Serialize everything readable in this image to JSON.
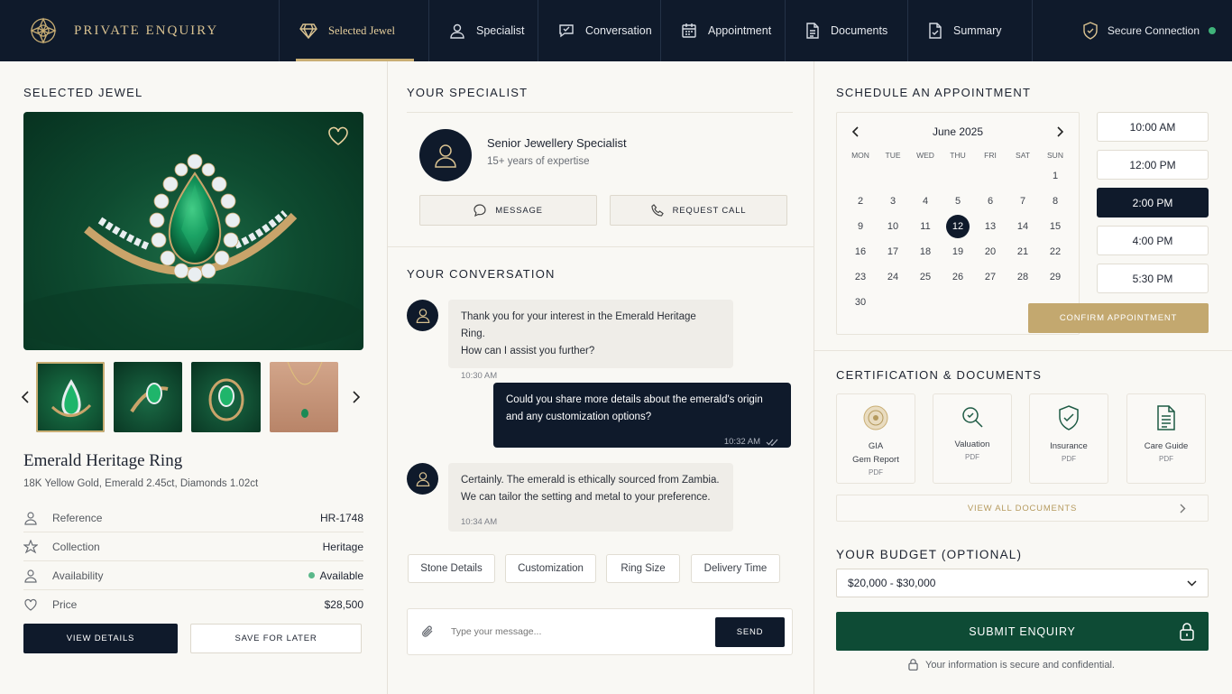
{
  "brand": {
    "name": "PRIVATE ENQUIRY"
  },
  "nav": {
    "items": [
      {
        "label": "Selected Jewel",
        "icon": "diamond-icon",
        "active": true
      },
      {
        "label": "Specialist",
        "icon": "user-icon"
      },
      {
        "label": "Conversation",
        "icon": "chat-icon"
      },
      {
        "label": "Appointment",
        "icon": "calendar-icon"
      },
      {
        "label": "Documents",
        "icon": "document-icon"
      },
      {
        "label": "Summary",
        "icon": "summary-icon"
      }
    ],
    "secure_label": "Secure Connection"
  },
  "jewel": {
    "section_title": "SELECTED JEWEL",
    "name": "Emerald Heritage Ring",
    "description": "18K Yellow Gold, Emerald 2.45ct, Diamonds 1.02ct",
    "specs": [
      {
        "label": "Reference",
        "value": "HR-1748",
        "icon": "person-icon"
      },
      {
        "label": "Collection",
        "value": "Heritage",
        "icon": "star-icon"
      },
      {
        "label": "Availability",
        "value": "Available",
        "icon": "person-icon"
      },
      {
        "label": "Price",
        "value": "$28,500",
        "icon": "tag-icon"
      }
    ],
    "view_details": "VIEW DETAILS",
    "save_later": "SAVE FOR LATER"
  },
  "specialist": {
    "section_title": "YOUR SPECIALIST",
    "title": "Senior Jewellery Specialist",
    "subtitle": "15+ years of expertise",
    "message_btn": "MESSAGE",
    "call_btn": "REQUEST CALL"
  },
  "conversation": {
    "section_title": "YOUR CONVERSATION",
    "messages": [
      {
        "from": "specialist",
        "lines": [
          "Thank you for your interest in the Emerald Heritage Ring.",
          "How can I assist you further?"
        ],
        "time": "10:30 AM"
      },
      {
        "from": "user",
        "lines": [
          "Could you share more details about the emerald's origin",
          "and any customization options?"
        ],
        "time": "10:32 AM"
      },
      {
        "from": "specialist",
        "lines": [
          "Certainly. The emerald is ethically sourced from Zambia.",
          "We can tailor the setting and metal to your preference."
        ],
        "time": "10:34 AM"
      }
    ],
    "chips": [
      "Stone Details",
      "Customization",
      "Ring Size",
      "Delivery Time"
    ],
    "input_placeholder": "Type your message...",
    "send": "SEND"
  },
  "appointment": {
    "section_title": "SCHEDULE AN APPOINTMENT",
    "month": "June 2025",
    "weekdays": [
      "MON",
      "TUE",
      "WED",
      "THU",
      "FRI",
      "SAT",
      "SUN"
    ],
    "days": [
      "",
      "",
      "",
      "",
      "",
      "",
      "1",
      "2",
      "3",
      "4",
      "5",
      "6",
      "7",
      "8",
      "9",
      "10",
      "11",
      "12",
      "13",
      "14",
      "15",
      "16",
      "17",
      "18",
      "19",
      "20",
      "21",
      "22",
      "23",
      "24",
      "25",
      "26",
      "27",
      "28",
      "29",
      "30"
    ],
    "selected_day": "12",
    "slots": [
      "10:00 AM",
      "12:00 PM",
      "2:00 PM",
      "4:00 PM",
      "5:30 PM"
    ],
    "selected_slot": "2:00 PM",
    "confirm": "CONFIRM APPOINTMENT"
  },
  "documents": {
    "section_title": "CERTIFICATION & DOCUMENTS",
    "items": [
      {
        "name": "GIA",
        "name2": "Gem Report",
        "type": "PDF"
      },
      {
        "name": "Valuation",
        "name2": "",
        "type": "PDF"
      },
      {
        "name": "Insurance",
        "name2": "",
        "type": "PDF"
      },
      {
        "name": "Care Guide",
        "name2": "",
        "type": "PDF"
      }
    ],
    "view_all": "VIEW ALL DOCUMENTS"
  },
  "budget": {
    "section_title": "YOUR BUDGET (OPTIONAL)",
    "value": "$20,000 - $30,000"
  },
  "submit": {
    "label": "SUBMIT ENQUIRY",
    "note": "Your information is secure and confidential."
  },
  "colors": {
    "navy": "#0f1a2b",
    "gold": "#c9ae74",
    "emerald": "#0e4b35",
    "available": "#3fb37a"
  }
}
